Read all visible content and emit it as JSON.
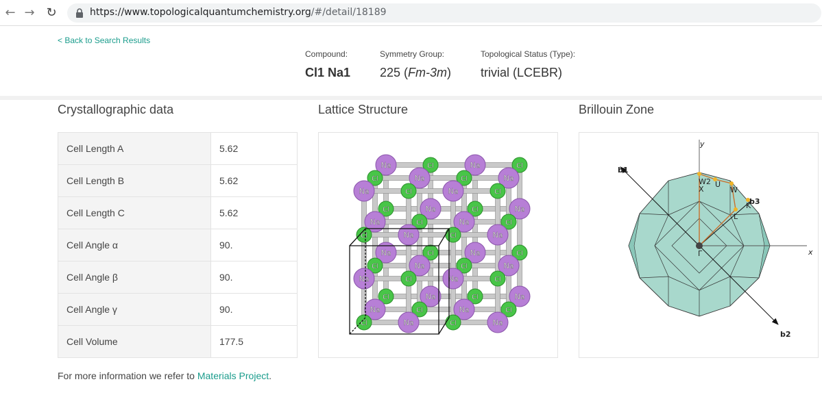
{
  "browser": {
    "url_host": "https://www.topologicalquantumchemistry.org",
    "url_path": "/#/detail/18189"
  },
  "header": {
    "back_link": "< Back to Search Results",
    "compound_label": "Compound:",
    "compound_value": "Cl1 Na1",
    "symmetry_label": "Symmetry Group:",
    "symmetry_number": "225",
    "symmetry_symbol": "Fm-3m",
    "topo_label": "Topological Status (Type):",
    "topo_value": "trivial (LCEBR)"
  },
  "sections": {
    "crystallographic": "Crystallographic data",
    "lattice": "Lattice Structure",
    "brillouin": "Brillouin Zone"
  },
  "crystallographic_table": [
    {
      "key": "Cell Length A",
      "value": "5.62"
    },
    {
      "key": "Cell Length B",
      "value": "5.62"
    },
    {
      "key": "Cell Length C",
      "value": "5.62"
    },
    {
      "key": "Cell Angle α",
      "value": "90."
    },
    {
      "key": "Cell Angle β",
      "value": "90."
    },
    {
      "key": "Cell Angle γ",
      "value": "90."
    },
    {
      "key": "Cell Volume",
      "value": "177.5"
    }
  ],
  "lattice": {
    "atom_na": "Na",
    "atom_cl": "Cl",
    "na_color": "#b77fd6",
    "cl_color": "#48c548"
  },
  "brillouin": {
    "fill_color": "#a8d8cc",
    "labels": [
      "W2",
      "U",
      "W",
      "b3",
      "X",
      "K",
      "L",
      "Γ",
      "x",
      "y",
      "b1",
      "b2"
    ]
  },
  "footer": {
    "text": "For more information we refer to ",
    "link": "Materials Project",
    "end": "."
  }
}
